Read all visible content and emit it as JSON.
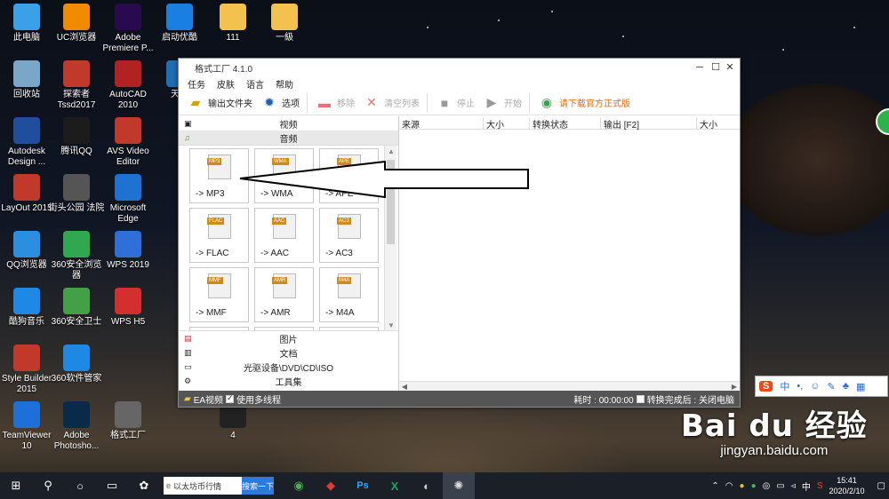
{
  "desktop": {
    "icons": [
      {
        "label": "此电脑",
        "icon": "computer-icon",
        "color": "#3aa0e8"
      },
      {
        "label": "UC浏览器",
        "icon": "uc-browser-icon",
        "color": "#f08a00"
      },
      {
        "label": "Adobe Premiere P...",
        "icon": "premiere-icon",
        "color": "#2a0a4e"
      },
      {
        "label": "启动优酷",
        "icon": "youku-icon",
        "color": "#1a7fe0"
      },
      {
        "label": "111",
        "icon": "folder-icon",
        "color": "#f2c14e"
      },
      {
        "label": "一級",
        "icon": "folder-icon",
        "color": "#f2c14e"
      },
      {
        "label": "回收站",
        "icon": "recycle-bin-icon",
        "color": "#7aa7c7"
      },
      {
        "label": "探索者 Tssd2017",
        "icon": "tssd-icon",
        "color": "#c0392b"
      },
      {
        "label": "AutoCAD 2010",
        "icon": "autocad-icon",
        "color": "#b22222"
      },
      {
        "label": "天正",
        "icon": "tangent-icon",
        "color": "#1d6fb8"
      },
      {
        "label": "Autodesk Design ...",
        "icon": "autodesk-icon",
        "color": "#1f4e9c"
      },
      {
        "label": "腾讯QQ",
        "icon": "qq-icon",
        "color": "#1c1c1c"
      },
      {
        "label": "AVS Video Editor",
        "icon": "avs-icon",
        "color": "#c0392b"
      },
      {
        "label": "LayOut 2015",
        "icon": "layout-icon",
        "color": "#c0392b"
      },
      {
        "label": "街头公园 法院",
        "icon": "document-icon",
        "color": "#555555"
      },
      {
        "label": "Microsoft Edge",
        "icon": "edge-icon",
        "color": "#1e73d2"
      },
      {
        "label": "QQ浏览器",
        "icon": "qq-browser-icon",
        "color": "#2a8fe0"
      },
      {
        "label": "360安全浏览器",
        "icon": "360-browser-icon",
        "color": "#2fa84f"
      },
      {
        "label": "WPS 2019",
        "icon": "wps-icon",
        "color": "#2e6fd8"
      },
      {
        "label": "酷狗音乐",
        "icon": "kugou-icon",
        "color": "#1e88e5"
      },
      {
        "label": "360安全卫士",
        "icon": "360-guard-icon",
        "color": "#43a047"
      },
      {
        "label": "WPS H5",
        "icon": "wps-h5-icon",
        "color": "#d32f2f"
      },
      {
        "label": "Style Builder 2015",
        "icon": "style-builder-icon",
        "color": "#c0392b"
      },
      {
        "label": "360软件管家",
        "icon": "360-software-icon",
        "color": "#1e88e5"
      },
      {
        "label": "TeamViewer 10",
        "icon": "teamviewer-icon",
        "color": "#1e6fd8"
      },
      {
        "label": "Adobe Photosho...",
        "icon": "photoshop-icon",
        "color": "#0a2a4a"
      },
      {
        "label": "格式工厂",
        "icon": "format-factory-icon",
        "color": "#666666"
      },
      {
        "label": "4",
        "icon": "image-thumbnail-icon",
        "color": "#222222"
      }
    ]
  },
  "window": {
    "title": "格式工厂 4.1.0",
    "menu": [
      "任务",
      "皮肤",
      "语言",
      "帮助"
    ],
    "toolbar": {
      "output_folder": "输出文件夹",
      "options": "选项",
      "remove": "移除",
      "clear_list": "清空列表",
      "stop": "停止",
      "start": "开始",
      "download": "请下载官方正式版"
    },
    "categories_top": [
      "视频",
      "音频"
    ],
    "categories_bottom": [
      "图片",
      "文档",
      "光驱设备\\DVD\\CD\\ISO",
      "工具集"
    ],
    "audio_tiles": [
      {
        "label": "-> MP3",
        "tag": "MP3"
      },
      {
        "label": "-> WMA",
        "tag": "WMA"
      },
      {
        "label": "-> APE",
        "tag": "APE"
      },
      {
        "label": "-> FLAC",
        "tag": "FLAC"
      },
      {
        "label": "-> AAC",
        "tag": "AAC"
      },
      {
        "label": "-> AC3",
        "tag": "AC3"
      },
      {
        "label": "-> MMF",
        "tag": "MMF"
      },
      {
        "label": "-> AMR",
        "tag": "AMR"
      },
      {
        "label": "-> M4A",
        "tag": "M4A"
      }
    ],
    "columns": [
      "来源",
      "大小",
      "转换状态",
      "输出 [F2]",
      "大小"
    ],
    "status": {
      "ea_video": "EA视频",
      "multithread": "使用多线程",
      "elapsed": "耗时 : 00:00:00",
      "shutdown": "转换完成后 : 关闭电脑"
    }
  },
  "taskbar": {
    "search_text": "以太坊币行情",
    "search_button": "搜索一下",
    "ime": "中",
    "time": "15:41",
    "date": "2020/2/10"
  },
  "sogou": {
    "logo": "S",
    "mode": "中"
  },
  "watermark": {
    "brand": "Bai du 经验",
    "url": "jingyan.baidu.com"
  }
}
